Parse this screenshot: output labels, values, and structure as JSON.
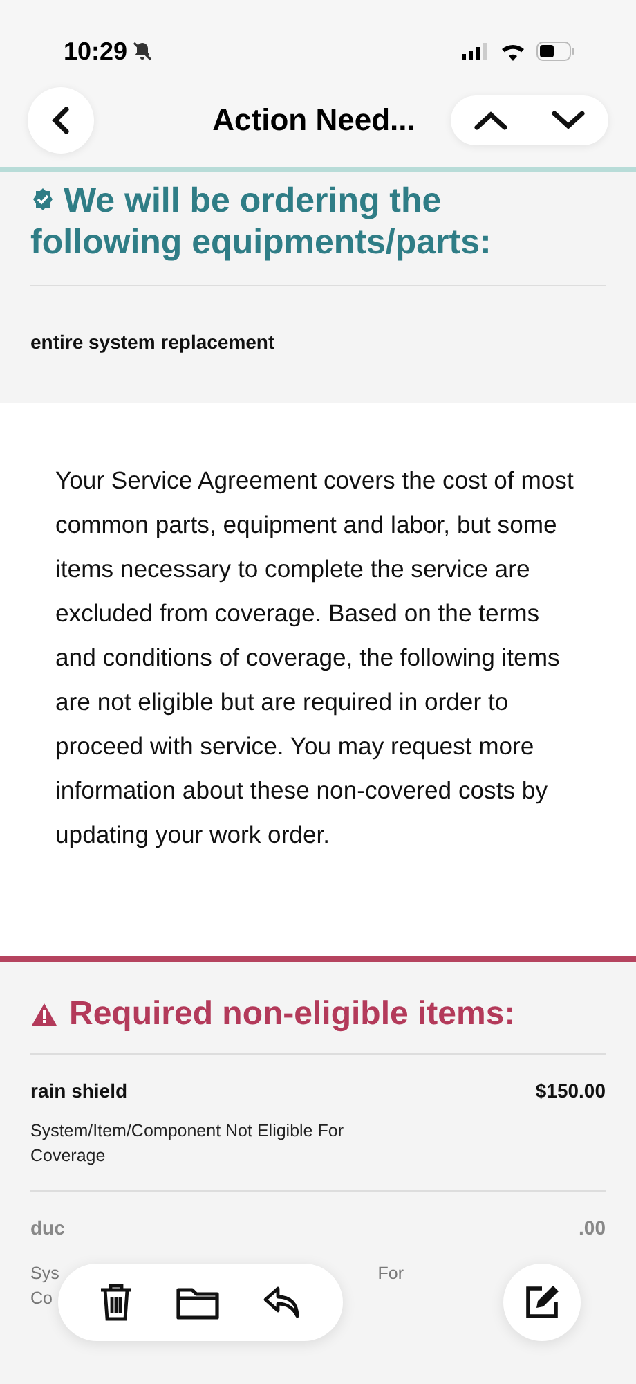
{
  "status_bar": {
    "time": "10:29",
    "silent": true
  },
  "nav": {
    "title": "Action Need..."
  },
  "ordering": {
    "heading": "We will be ordering the following equipments/parts:",
    "items": [
      "entire system replacement"
    ]
  },
  "notice": "Your Service Agreement covers the cost of most common parts, equipment and labor, but some items necessary to complete the service are excluded from coverage. Based on the terms and conditions of coverage, the following items are not eligible but are required in order to proceed with service. You may request more information about these non-covered costs by updating your work order.",
  "non_eligible": {
    "heading": "Required non-eligible items:",
    "items": [
      {
        "name": "rain shield",
        "price": "$150.00",
        "description": "System/Item/Component Not Eligible For Coverage"
      },
      {
        "name": "duc",
        "price": ".00",
        "description_start": "Sys",
        "description_end": "For",
        "description_line2": "Co"
      }
    ]
  }
}
